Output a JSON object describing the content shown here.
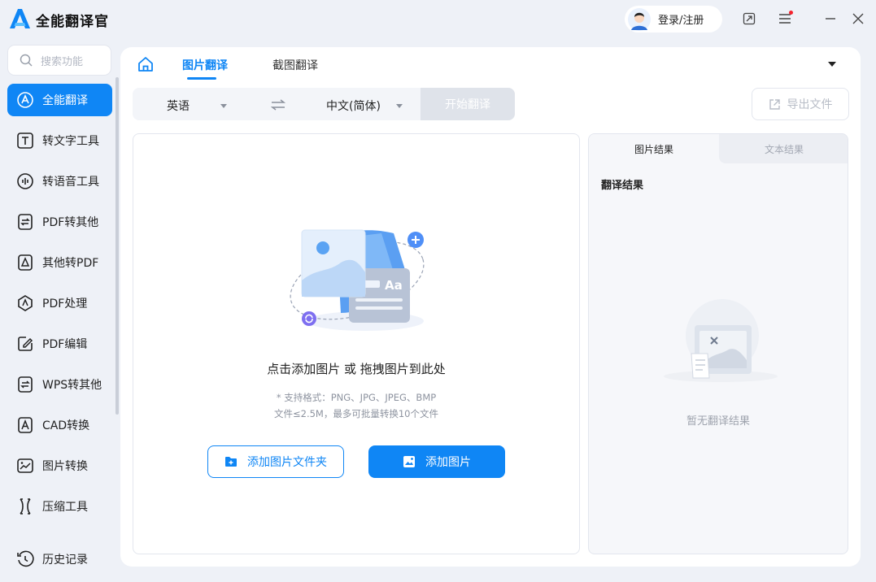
{
  "app": {
    "title": "全能翻译官"
  },
  "header": {
    "login_label": "登录/注册"
  },
  "sidebar": {
    "search_placeholder": "搜索功能",
    "items": [
      {
        "label": "全能翻译",
        "icon": "translate-icon",
        "active": true
      },
      {
        "label": "转文字工具",
        "icon": "text-tool-icon"
      },
      {
        "label": "转语音工具",
        "icon": "voice-tool-icon"
      },
      {
        "label": "PDF转其他",
        "icon": "pdf-convert-icon"
      },
      {
        "label": "其他转PDF",
        "icon": "to-pdf-icon"
      },
      {
        "label": "PDF处理",
        "icon": "pdf-process-icon"
      },
      {
        "label": "PDF编辑",
        "icon": "pdf-edit-icon"
      },
      {
        "label": "WPS转其他",
        "icon": "wps-convert-icon"
      },
      {
        "label": "CAD转换",
        "icon": "cad-convert-icon"
      },
      {
        "label": "图片转换",
        "icon": "image-convert-icon"
      },
      {
        "label": "压缩工具",
        "icon": "compress-icon"
      }
    ],
    "history_label": "历史记录"
  },
  "main": {
    "tabs": [
      {
        "label": "图片翻译",
        "active": true
      },
      {
        "label": "截图翻译"
      }
    ],
    "source_lang": "英语",
    "target_lang": "中文(简体)",
    "start_button": "开始翻译",
    "export_button": "导出文件",
    "upload": {
      "title": "点击添加图片 或 拖拽图片到此处",
      "hint_formats": "* 支持格式：PNG、JPG、JPEG、BMP",
      "hint_limits": "文件≤2.5M，最多可批量转换10个文件",
      "add_folder_button": "添加图片文件夹",
      "add_image_button": "添加图片"
    },
    "result": {
      "tabs": [
        {
          "label": "图片结果",
          "active": true
        },
        {
          "label": "文本结果"
        }
      ],
      "title": "翻译结果",
      "empty_text": "暂无翻译结果"
    }
  },
  "colors": {
    "accent": "#0f86f5",
    "background": "#eef1f7",
    "disabled": "#dfe3ea"
  }
}
